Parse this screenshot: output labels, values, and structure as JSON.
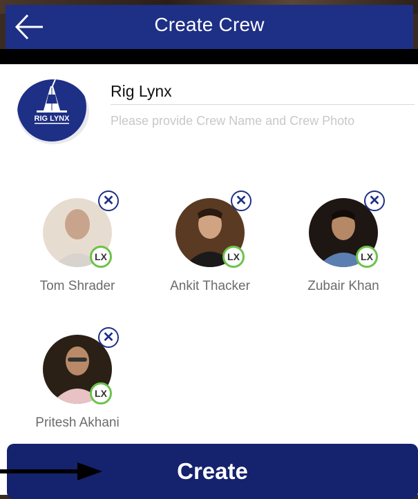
{
  "header": {
    "title": "Create Crew",
    "back_icon": "arrow-left-icon"
  },
  "crew": {
    "name": "Rig Lynx",
    "helper": "Please provide Crew Name and Crew Photo",
    "logo_text": "RIG LYNX"
  },
  "members": [
    {
      "name": "Tom Shrader",
      "badge": "LX"
    },
    {
      "name": "Ankit Thacker",
      "badge": "LX"
    },
    {
      "name": "Zubair Khan",
      "badge": "LX"
    },
    {
      "name": "Pritesh Akhani",
      "badge": "LX"
    }
  ],
  "remove_glyph": "✕",
  "create_button": {
    "label": "Create"
  },
  "colors": {
    "primary": "#1e2f86",
    "button": "#15226e",
    "badge_ring": "#6cc24a",
    "muted_text": "#6b6b6b"
  }
}
